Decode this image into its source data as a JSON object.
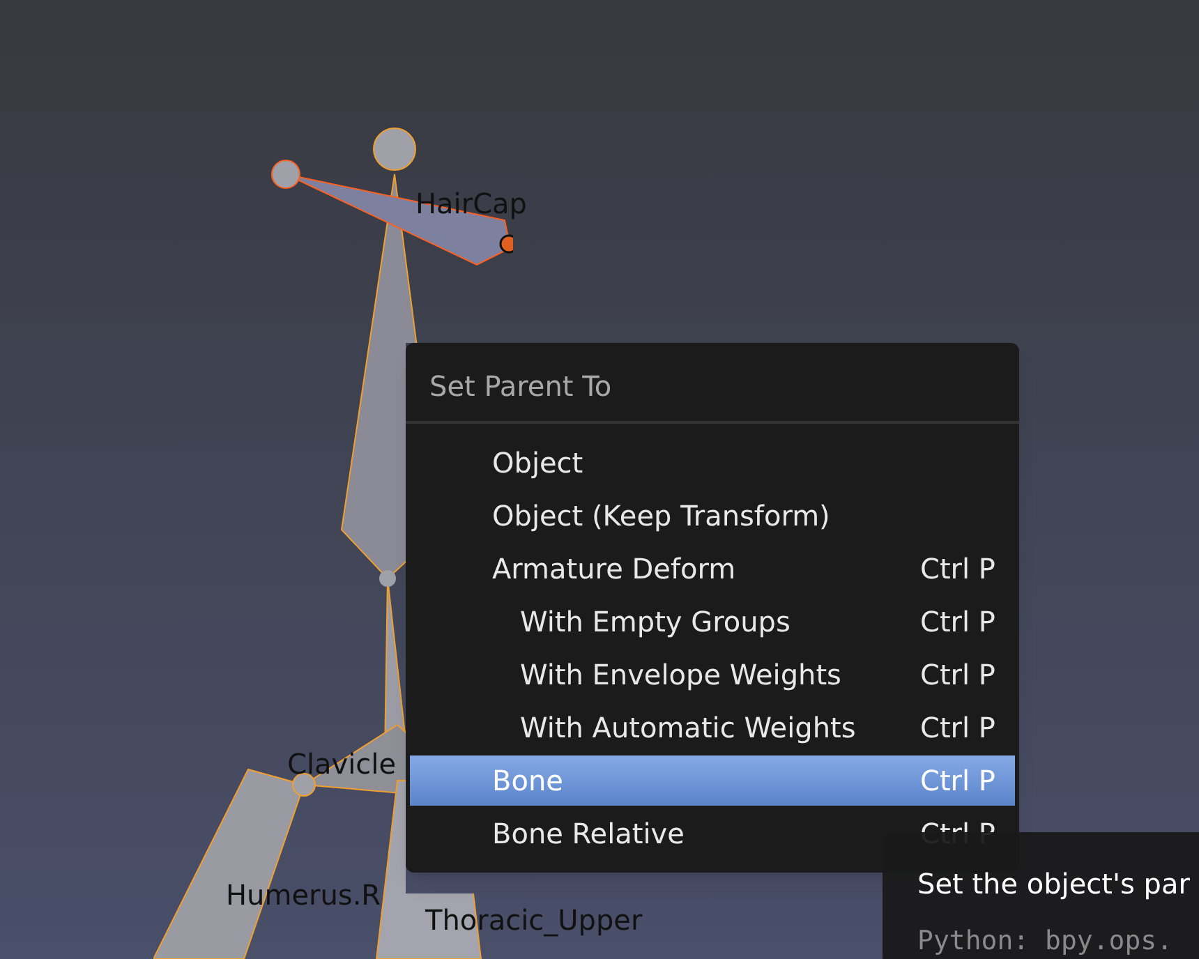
{
  "viewport": {
    "bone_labels": [
      {
        "text": "HairCap"
      },
      {
        "text": "Clavicle"
      },
      {
        "text": "Humerus.R"
      },
      {
        "text": "Thoracic_Upper"
      }
    ]
  },
  "menu": {
    "title": "Set Parent To",
    "items": [
      {
        "label": "Object",
        "selected": false
      },
      {
        "label": "Object (Keep Transform)",
        "selected": false
      },
      {
        "label": "Armature Deform",
        "shortcut": "Ctrl P",
        "selected": false,
        "children": [
          {
            "label": "With Empty Groups",
            "shortcut": "Ctrl P",
            "selected": false
          },
          {
            "label": "With Envelope Weights",
            "shortcut": "Ctrl P",
            "selected": false
          },
          {
            "label": "With Automatic Weights",
            "shortcut": "Ctrl P",
            "selected": false
          }
        ]
      },
      {
        "label": "Bone",
        "shortcut": "Ctrl P",
        "selected": true
      },
      {
        "label": "Bone Relative",
        "shortcut": "Ctrl P",
        "selected": false
      }
    ]
  },
  "tooltip": {
    "description": "Set the object's par",
    "python": "Python: bpy.ops."
  }
}
